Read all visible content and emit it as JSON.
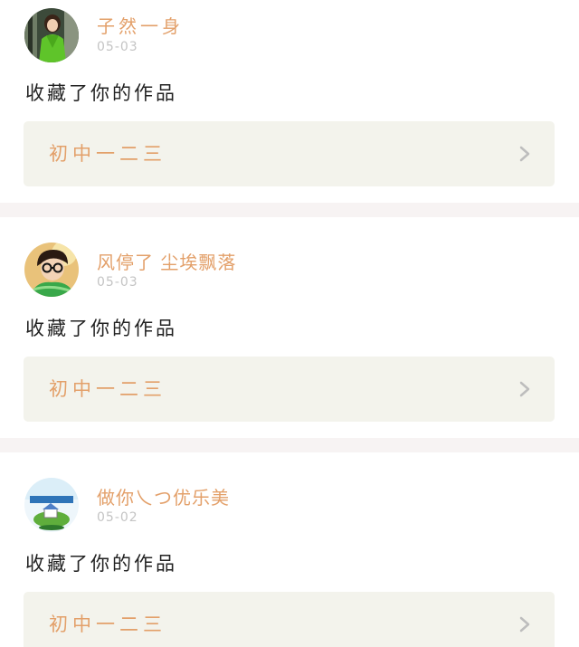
{
  "feed": [
    {
      "username": "子然一身",
      "date": "05-03",
      "action": "收藏了你的作品",
      "work_title": "初中一二三",
      "avatar_icon": "avatar-green-coat-girl"
    },
    {
      "username": "风停了 尘埃飘落",
      "date": "05-03",
      "action": "收藏了你的作品",
      "work_title": "初中一二三",
      "avatar_icon": "avatar-boy-glasses"
    },
    {
      "username": "做你乀つ优乐美",
      "date": "05-02",
      "action": "收藏了你的作品",
      "work_title": "初中一二三",
      "avatar_icon": "avatar-globe-house"
    }
  ],
  "colors": {
    "accent": "#e3a06a",
    "link_bg": "#f3f3ec",
    "divider": "#f7f3f3",
    "date": "#c4c4c4",
    "text": "#222222",
    "chevron": "#bdbdbd"
  }
}
